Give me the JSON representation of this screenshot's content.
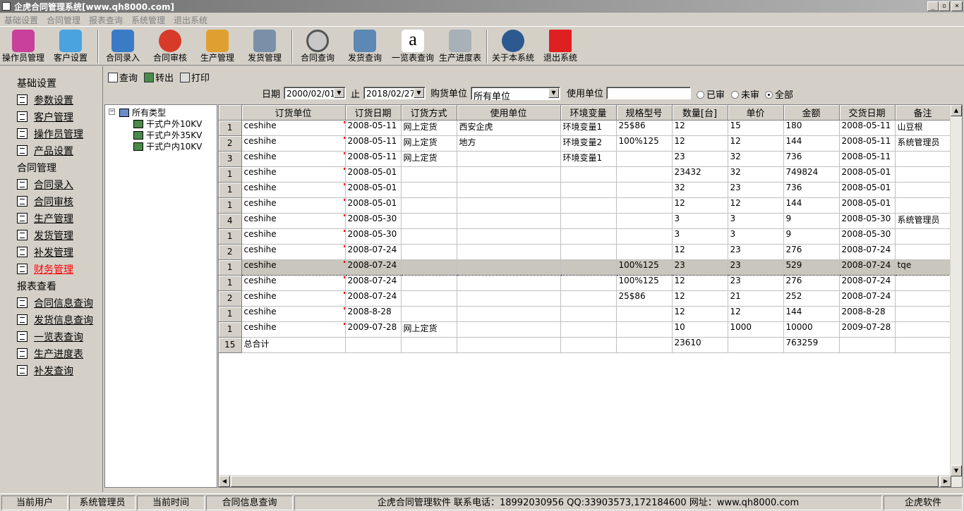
{
  "window": {
    "title": "企虎合同管理系统[www.qh8000.com]",
    "minimize": "_",
    "restore": "▫",
    "close": "×"
  },
  "menu": [
    "基础设置",
    "合同管理",
    "报表查询",
    "系统管理",
    "退出系统"
  ],
  "toolbar": [
    {
      "label": "操作员管理",
      "icon": "operator-icon",
      "color": "#c9409a"
    },
    {
      "label": "客户设置",
      "icon": "customer-icon",
      "color": "#4aa3df"
    },
    {
      "label": "合同录入",
      "icon": "contract-entry-icon",
      "color": "#3a7bc8"
    },
    {
      "label": "合同审核",
      "icon": "contract-audit-icon",
      "color": "#d83a2a"
    },
    {
      "label": "生产管理",
      "icon": "production-icon",
      "color": "#e0a030"
    },
    {
      "label": "发货管理",
      "icon": "shipping-icon",
      "color": "#7a8fa8"
    },
    {
      "label": "合同查询",
      "icon": "magnifier-icon",
      "color": "#c8c8c8"
    },
    {
      "label": "发货查询",
      "icon": "database-globe-icon",
      "color": "#5b88b5"
    },
    {
      "label": "一览表查询",
      "icon": "amazon-icon",
      "color": "#ffffff"
    },
    {
      "label": "生产进度表",
      "icon": "server-icon",
      "color": "#a8b0b8"
    },
    {
      "label": "关于本系统",
      "icon": "about-icon",
      "color": "#2c5a90"
    },
    {
      "label": "退出系统",
      "icon": "exit-cube-icon",
      "color": "#e02020"
    }
  ],
  "nav": {
    "sections": [
      {
        "title": "基础设置",
        "items": [
          "参数设置",
          "客户管理",
          "操作员管理",
          "产品设置"
        ]
      },
      {
        "title": "合同管理",
        "items": [
          "合同录入",
          "合同审核",
          "生产管理",
          "发货管理",
          "补发管理",
          "财务管理"
        ]
      },
      {
        "title": "报表查看",
        "items": [
          "合同信息查询",
          "发货信息查询",
          "一览表查询",
          "生产进度表",
          "补发查询"
        ]
      }
    ],
    "active": "财务管理"
  },
  "query": {
    "search": "查询",
    "export": "转出",
    "print": "打印",
    "date_label": "日期",
    "date_from": "2000/02/01",
    "to_label": "止",
    "date_to": "2018/02/27",
    "buyer_label": "购货单位",
    "buyer_value": "所有单位",
    "user_label": "使用单位",
    "user_value": "",
    "radios": [
      {
        "label": "已审",
        "checked": false
      },
      {
        "label": "未审",
        "checked": false
      },
      {
        "label": "全部",
        "checked": true
      }
    ]
  },
  "tree": {
    "root": "所有类型",
    "expander": "−",
    "children": [
      "干式户外10KV",
      "干式户外35KV",
      "干式户内10KV"
    ]
  },
  "grid": {
    "headers": [
      "订货单位",
      "订货日期",
      "订货方式",
      "使用单位",
      "环境变量",
      "规格型号",
      "数量[台]",
      "单价",
      "金额",
      "交货日期",
      "备注"
    ],
    "rows": [
      {
        "n": "1",
        "c": [
          "ceshihe",
          "2008-05-11",
          "网上定货",
          "西安企虎",
          "环境变量1",
          "25$86",
          "12",
          "15",
          "180",
          "2008-05-11",
          "山豆根"
        ]
      },
      {
        "n": "2",
        "c": [
          "ceshihe",
          "2008-05-11",
          "网上定货",
          "地方",
          "环境变量2",
          "100%125",
          "12",
          "12",
          "144",
          "2008-05-11",
          "系统管理员"
        ]
      },
      {
        "n": "3",
        "c": [
          "ceshihe",
          "2008-05-11",
          "网上定货",
          "",
          "环境变量1",
          "",
          "23",
          "32",
          "736",
          "2008-05-11",
          ""
        ]
      },
      {
        "n": "1",
        "c": [
          "ceshihe",
          "2008-05-01",
          "",
          "",
          "",
          "",
          "23432",
          "32",
          "749824",
          "2008-05-01",
          ""
        ]
      },
      {
        "n": "1",
        "c": [
          "ceshihe",
          "2008-05-01",
          "",
          "",
          "",
          "",
          "32",
          "23",
          "736",
          "2008-05-01",
          ""
        ]
      },
      {
        "n": "1",
        "c": [
          "ceshihe",
          "2008-05-01",
          "",
          "",
          "",
          "",
          "12",
          "12",
          "144",
          "2008-05-01",
          ""
        ]
      },
      {
        "n": "4",
        "c": [
          "ceshihe",
          "2008-05-30",
          "",
          "",
          "",
          "",
          "3",
          "3",
          "9",
          "2008-05-30",
          "系统管理员"
        ]
      },
      {
        "n": "1",
        "c": [
          "ceshihe",
          "2008-05-30",
          "",
          "",
          "",
          "",
          "3",
          "3",
          "9",
          "2008-05-30",
          ""
        ]
      },
      {
        "n": "2",
        "c": [
          "ceshihe",
          "2008-07-24",
          "",
          "",
          "",
          "",
          "12",
          "23",
          "276",
          "2008-07-24",
          ""
        ]
      },
      {
        "n": "1",
        "c": [
          "ceshihe",
          "2008-07-24",
          "",
          "",
          "",
          "100%125",
          "23",
          "23",
          "529",
          "2008-07-24",
          "tqe"
        ],
        "selected": true
      },
      {
        "n": "1",
        "c": [
          "ceshihe",
          "2008-07-24",
          "",
          "",
          "",
          "100%125",
          "12",
          "23",
          "276",
          "2008-07-24",
          ""
        ]
      },
      {
        "n": "2",
        "c": [
          "ceshihe",
          "2008-07-24",
          "",
          "",
          "",
          "25$86",
          "12",
          "21",
          "252",
          "2008-07-24",
          ""
        ]
      },
      {
        "n": "1",
        "c": [
          "ceshihe",
          "2008-8-28",
          "",
          "",
          "",
          "",
          "12",
          "12",
          "144",
          "2008-8-28",
          ""
        ]
      },
      {
        "n": "1",
        "c": [
          "ceshihe",
          "2009-07-28",
          "网上定货",
          "",
          "",
          "",
          "10",
          "1000",
          "10000",
          "2009-07-28",
          ""
        ]
      },
      {
        "n": "15",
        "c": [
          "总合计",
          "",
          "",
          "",
          "",
          "",
          "23610",
          "",
          "763259",
          "",
          ""
        ],
        "total": true
      }
    ]
  },
  "status": {
    "p1": "当前用户",
    "p2": "系统管理员",
    "p3": "当前时间",
    "p4": "合同信息查询",
    "p5": "企虎合同管理软件     联系电话：18992030956 QQ:33903573,172184600 网址：www.qh8000.com",
    "p6": "企虎软件"
  }
}
